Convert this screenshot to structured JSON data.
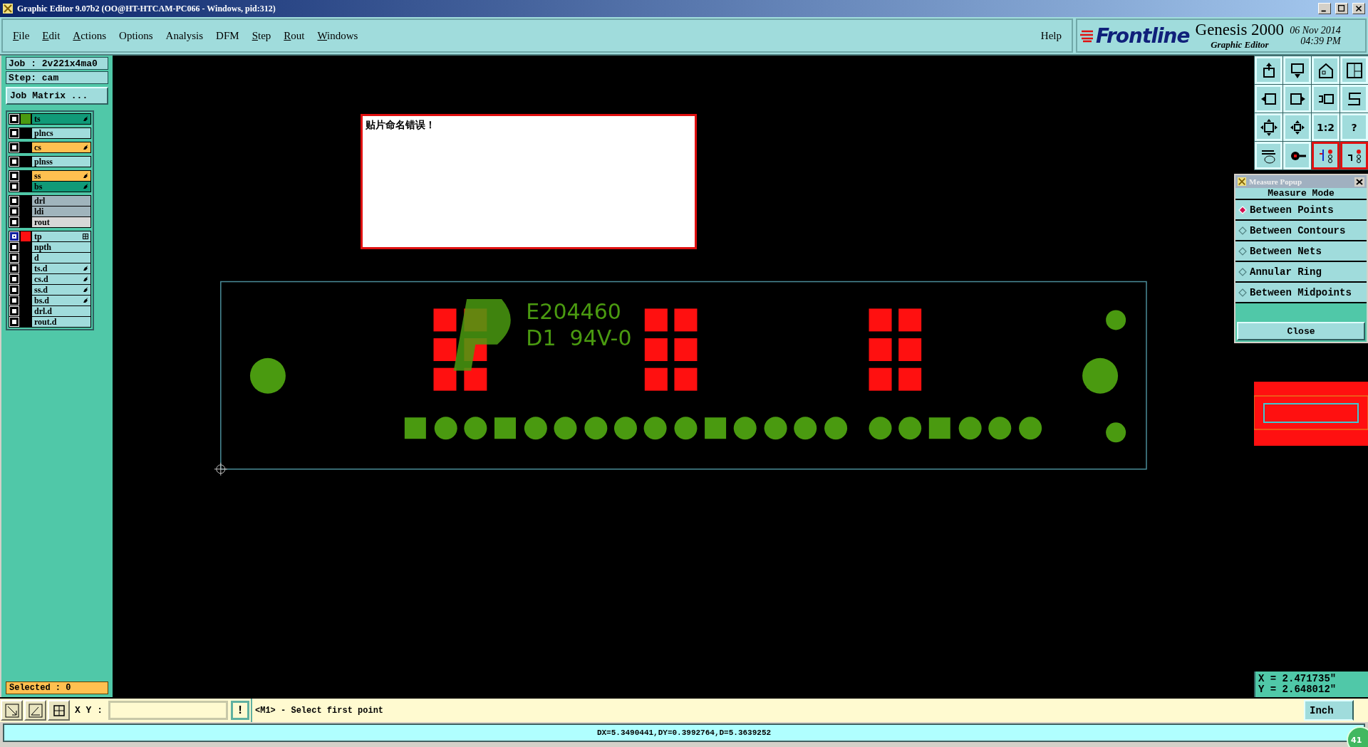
{
  "window": {
    "title": "Graphic Editor 9.07b2 (OO@HT-HTCAM-PC066 - Windows, pid:312)"
  },
  "menu": [
    {
      "label": "File",
      "mnemonic": true
    },
    {
      "label": "Edit",
      "mnemonic": true
    },
    {
      "label": "Actions",
      "mnemonic": true
    },
    {
      "label": "Options",
      "mnemonic": false
    },
    {
      "label": "Analysis",
      "mnemonic": false
    },
    {
      "label": "DFM",
      "mnemonic": false
    },
    {
      "label": "Step",
      "mnemonic": true
    },
    {
      "label": "Rout",
      "mnemonic": true
    },
    {
      "label": "Windows",
      "mnemonic": true
    }
  ],
  "help": "Help",
  "brand": {
    "logo": "Frontline",
    "product": "Genesis 2000",
    "subtitle": "Graphic Editor",
    "date": "06 Nov 2014",
    "time": "04:39 PM"
  },
  "job": {
    "job": "Job : 2v221x4ma0",
    "step": "Step: cam",
    "matrix_button": "Job Matrix ..."
  },
  "layer_groups": [
    [
      {
        "name": "ts",
        "color": "#109a78",
        "swatch": {
          "color": "#4a9a10"
        },
        "hand": true,
        "grid": false,
        "focused": false
      }
    ],
    [
      {
        "name": "plncs",
        "color": "#a0dcdc",
        "hand": false,
        "grid": false,
        "focused": false
      }
    ],
    [
      {
        "name": "cs",
        "color": "#ffc050",
        "hand": true,
        "grid": false,
        "focused": false
      }
    ],
    [
      {
        "name": "plnss",
        "color": "#a0dcdc",
        "hand": false,
        "grid": false,
        "focused": false
      }
    ],
    [
      {
        "name": "ss",
        "color": "#ffc050",
        "hand": true,
        "grid": false,
        "focused": false
      },
      {
        "name": "bs",
        "color": "#109a78",
        "hand": true,
        "grid": false,
        "focused": false
      }
    ],
    [
      {
        "name": "drl",
        "color": "#a0b4bc",
        "hand": false,
        "grid": false,
        "focused": false
      },
      {
        "name": "ldi",
        "color": "#a0b4bc",
        "hand": false,
        "grid": false,
        "focused": false
      },
      {
        "name": "rout",
        "color": "#d8d8d8",
        "hand": false,
        "grid": false,
        "focused": false
      }
    ],
    [
      {
        "name": "tp",
        "color": "#a0dcdc",
        "swatch": {
          "color": "#ff1010"
        },
        "hand": false,
        "grid": true,
        "focused": true
      },
      {
        "name": "npth",
        "color": "#a0dcdc",
        "hand": false,
        "grid": false,
        "focused": false
      },
      {
        "name": "d",
        "color": "#a0dcdc",
        "hand": false,
        "grid": false,
        "focused": false
      },
      {
        "name": "ts.d",
        "color": "#a0dcdc",
        "hand": true,
        "grid": false,
        "focused": false
      },
      {
        "name": "cs.d",
        "color": "#a0dcdc",
        "hand": true,
        "grid": false,
        "focused": false
      },
      {
        "name": "ss.d",
        "color": "#a0dcdc",
        "hand": true,
        "grid": false,
        "focused": false
      },
      {
        "name": "bs.d",
        "color": "#a0dcdc",
        "hand": true,
        "grid": false,
        "focused": false
      },
      {
        "name": "drl.d",
        "color": "#a0dcdc",
        "hand": false,
        "grid": false,
        "focused": false
      },
      {
        "name": "rout.d",
        "color": "#a0dcdc",
        "hand": false,
        "grid": false,
        "focused": false
      }
    ]
  ],
  "selected_count": "Selected : 0",
  "message_box": {
    "text": "贴片命名错误！"
  },
  "board": {
    "markings": [
      "E204460",
      "D1  94V-0"
    ]
  },
  "toolbar": [
    {
      "highlighted": false
    },
    {
      "highlighted": false
    },
    {
      "highlighted": false
    },
    {
      "highlighted": false
    },
    {
      "highlighted": false
    },
    {
      "highlighted": false
    },
    {
      "highlighted": false
    },
    {
      "highlighted": false
    },
    {
      "highlighted": false
    },
    {
      "highlighted": false
    },
    {
      "label": "1:2",
      "highlighted": false
    },
    {
      "label": "?",
      "highlighted": false
    },
    {
      "highlighted": false
    },
    {
      "highlighted": false
    },
    {
      "highlighted": true
    },
    {
      "highlighted": true
    }
  ],
  "measure_popup": {
    "title": "Measure Popup",
    "heading": "Measure Mode",
    "modes": [
      {
        "label": "Between Points",
        "selected": true
      },
      {
        "label": "Between Contours",
        "selected": false
      },
      {
        "label": "Between Nets",
        "selected": false
      },
      {
        "label": "Annular Ring",
        "selected": false
      },
      {
        "label": "Between Midpoints",
        "selected": false
      }
    ],
    "close": "Close"
  },
  "cursor": {
    "x": "X = 2.471735\"",
    "y": "Y = 2.648012\""
  },
  "command_bar": {
    "xy_label": "X Y :",
    "warn": "!",
    "prompt": "<M1> - Select first point",
    "units": "Inch"
  },
  "badge": "41",
  "status_bar": "DX=5.3490441,DY=0.3992764,D=5.3639252"
}
